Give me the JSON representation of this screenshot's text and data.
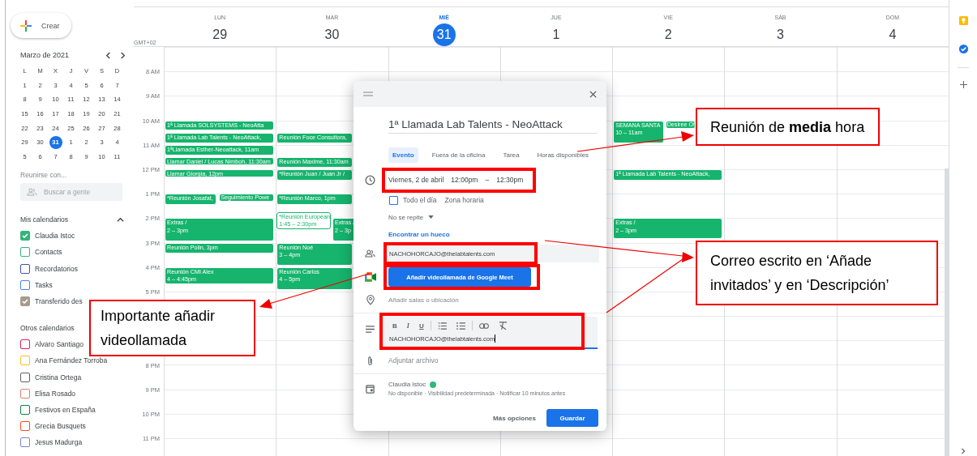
{
  "sidebar": {
    "create_button": "Crear",
    "mini_calendar": {
      "title": "Marzo de 2021",
      "weekdays": [
        "L",
        "M",
        "X",
        "J",
        "V",
        "S",
        "D"
      ],
      "weeks": [
        [
          {
            "day": "1",
            "selected": false
          },
          {
            "day": "2",
            "selected": false
          },
          {
            "day": "3",
            "selected": false
          },
          {
            "day": "4",
            "selected": false
          },
          {
            "day": "5",
            "selected": false
          },
          {
            "day": "6",
            "selected": false
          },
          {
            "day": "7",
            "selected": false
          }
        ],
        [
          {
            "day": "8",
            "selected": false
          },
          {
            "day": "9",
            "selected": false
          },
          {
            "day": "10",
            "selected": false
          },
          {
            "day": "11",
            "selected": false
          },
          {
            "day": "12",
            "selected": false
          },
          {
            "day": "13",
            "selected": false
          },
          {
            "day": "14",
            "selected": false
          }
        ],
        [
          {
            "day": "15",
            "selected": false
          },
          {
            "day": "16",
            "selected": false
          },
          {
            "day": "17",
            "selected": false
          },
          {
            "day": "18",
            "selected": false
          },
          {
            "day": "19",
            "selected": false
          },
          {
            "day": "20",
            "selected": false
          },
          {
            "day": "21",
            "selected": false
          }
        ],
        [
          {
            "day": "22",
            "selected": false
          },
          {
            "day": "23",
            "selected": false
          },
          {
            "day": "24",
            "selected": false
          },
          {
            "day": "25",
            "selected": false
          },
          {
            "day": "26",
            "selected": false
          },
          {
            "day": "27",
            "selected": false
          },
          {
            "day": "28",
            "selected": false
          }
        ],
        [
          {
            "day": "29",
            "selected": false
          },
          {
            "day": "30",
            "selected": false
          },
          {
            "day": "31",
            "selected": true
          },
          {
            "day": "1",
            "selected": false
          },
          {
            "day": "2",
            "selected": false
          },
          {
            "day": "3",
            "selected": false
          },
          {
            "day": "4",
            "selected": false
          }
        ],
        [
          {
            "day": "5",
            "selected": false
          },
          {
            "day": "6",
            "selected": false
          },
          {
            "day": "7",
            "selected": false
          },
          {
            "day": "8",
            "selected": false
          },
          {
            "day": "9",
            "selected": false
          },
          {
            "day": "10",
            "selected": false
          },
          {
            "day": "11",
            "selected": false
          }
        ]
      ]
    },
    "meet_with": {
      "title": "Reunirse con...",
      "placeholder": "Buscar a gente"
    },
    "my_calendars_title": "Mis calendarios",
    "my_calendars": [
      {
        "name": "Claudia Istoc",
        "checked": true,
        "color": "#33b679"
      },
      {
        "name": "Contacts",
        "checked": false,
        "color": "#33b679"
      },
      {
        "name": "Recordatorios",
        "checked": false,
        "color": "#3f51b5"
      },
      {
        "name": "Tasks",
        "checked": false,
        "color": "#4285f4"
      },
      {
        "name": "Transferido des",
        "checked": true,
        "color": "#a79b8e"
      }
    ],
    "other_calendars_title": "Otros calendarios",
    "other_calendars": [
      {
        "name": "Alvaro Santiago",
        "checked": false,
        "color": "#e91e63"
      },
      {
        "name": "Ana Fernández Torroba",
        "checked": false,
        "color": "#f6bf26"
      },
      {
        "name": "Cristina Ortega",
        "checked": false,
        "color": "#616161"
      },
      {
        "name": "Elisa Rosado",
        "checked": false,
        "color": "#e67c73"
      },
      {
        "name": "Festivos en España",
        "checked": false,
        "color": "#0b8043"
      },
      {
        "name": "Grecia Busquets",
        "checked": false,
        "color": "#f4511e"
      },
      {
        "name": "Jesus Madurga",
        "checked": false,
        "color": "#7986cb"
      }
    ]
  },
  "calendar": {
    "timezone": "GMT+02",
    "hour_labels": [
      "8 AM",
      "9 AM",
      "10 AM",
      "11 AM",
      "12 PM",
      "1 PM",
      "2 PM",
      "3 PM",
      "4 PM",
      "5 PM",
      "8 PM",
      "9 PM",
      "10 PM",
      "11 PM"
    ],
    "days": [
      {
        "weekday": "LUN",
        "date": "29",
        "selected": false,
        "events": [
          {
            "kind": "filled",
            "title": "1ª Llamada SOLSYSTEMS - NeoAtta"
          },
          {
            "kind": "filled",
            "title": "1ª Llamada Lab Talents - NeoAttack,"
          },
          {
            "kind": "filled",
            "title": "1ªLlamada Esther-Neoattack, 11am"
          },
          {
            "kind": "filled",
            "title": "Llamar Daniel / Lucas Nimboh, 11:30am"
          },
          {
            "kind": "filled",
            "title": "Llamar Giorgia, 12pm"
          },
          {
            "kind": "filled",
            "title": "*Reunión Josafat,"
          },
          {
            "kind": "chip",
            "title": "Seguimiento Powe"
          },
          {
            "kind": "filled",
            "title": "Extras /",
            "time": "2 – 3pm"
          },
          {
            "kind": "filled",
            "title": "Reunión Polin, 3pm"
          },
          {
            "kind": "filled",
            "title": "Reunión CMI Alex",
            "time": "4 – 4:45pm"
          }
        ]
      },
      {
        "weekday": "MAR",
        "date": "30",
        "selected": false,
        "events": [
          {
            "kind": "filled",
            "title": "Reunión Foce Consultora,"
          },
          {
            "kind": "filled",
            "title": "Reunión Maxime, 11:30am"
          },
          {
            "kind": "filled",
            "title": "*Reunión Juan / Juan Jr /"
          },
          {
            "kind": "filled",
            "title": "*Reunión Marco, 1pm"
          },
          {
            "kind": "outlined",
            "title": "*Reunión European",
            "time": "1:45 – 2:30pm"
          },
          {
            "kind": "filled",
            "title": "Extras /",
            "time": "2 – 3p"
          },
          {
            "kind": "filled",
            "title": "Reunión Noé",
            "time": "3 – 4pm"
          },
          {
            "kind": "filled",
            "title": "Reunión Carlos",
            "time": "4 – 5pm"
          }
        ]
      },
      {
        "weekday": "MIÉ",
        "date": "31",
        "selected": true
      },
      {
        "weekday": "JUE",
        "date": "1",
        "selected": false
      },
      {
        "weekday": "VIE",
        "date": "2",
        "selected": false,
        "events": [
          {
            "kind": "filled",
            "title": "SEMANA SANTA",
            "time": "10 – 11am"
          },
          {
            "kind": "chip",
            "title": "Desiree Of"
          },
          {
            "kind": "filled",
            "title": "1ª Llamada Lab Talents - NeoAttack,"
          },
          {
            "kind": "filled",
            "title": "Extras /",
            "time": "2 – 3pm"
          }
        ]
      },
      {
        "weekday": "SÁB",
        "date": "3",
        "selected": false
      },
      {
        "weekday": "DOM",
        "date": "4",
        "selected": false
      }
    ]
  },
  "event_dialog": {
    "title": "1ª Llamada Lab Talents - NeoAttack",
    "tabs": [
      {
        "label": "Evento",
        "selected": true
      },
      {
        "label": "Fuera de la oficina",
        "selected": false
      },
      {
        "label": "Tarea",
        "selected": false
      },
      {
        "label": "Horas disponibles",
        "selected": false
      }
    ],
    "date": {
      "day": "Viernes, 2 de abril",
      "start": "12:00pm",
      "separator": "–",
      "end": "12:30pm",
      "highlighted": true
    },
    "all_day": {
      "label": "Todo el día",
      "checked": false
    },
    "time_zone": "Zona horaria",
    "repeat": "No se repite",
    "find_time": "Encontrar un hueco",
    "guests": {
      "value": "NACHOHORCAJO@thelabtalents.com",
      "highlighted": true
    },
    "meet_button": {
      "label": "Añadir videollamada de Google Meet",
      "highlighted": true
    },
    "location": {
      "placeholder": "Añadir salas o ubicación"
    },
    "description": {
      "toolbar": [
        "B",
        "I",
        "U"
      ],
      "value": "NACHOHORCAJO@thelabtalents.com",
      "highlighted": true
    },
    "attachment": "Adjuntar archivo",
    "calendar": {
      "name": "Claudia Istoc",
      "color": "#33b679",
      "details": "No disponible · Visibilidad predeterminada · Notificar 10 minutos antes"
    },
    "buttons": [
      {
        "label": "Más opciones",
        "kind": "text"
      },
      {
        "label": "Guardar",
        "kind": "primary"
      }
    ]
  },
  "annotations": [
    {
      "text": "Reunión de **media** hora"
    },
    {
      "text": "Correo escrito en ‘Añade invitados’ y en ‘Descripción’"
    },
    {
      "text": "Importante añadir videollamada"
    }
  ]
}
